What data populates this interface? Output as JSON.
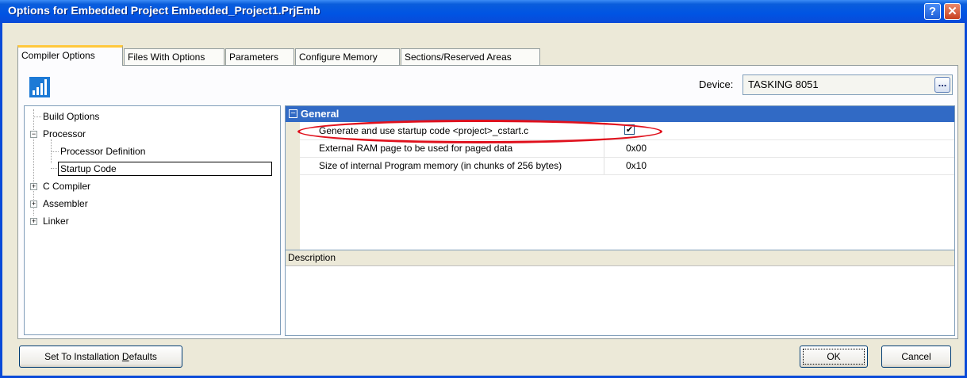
{
  "window": {
    "title": "Options for Embedded Project Embedded_Project1.PrjEmb",
    "help_label": "?",
    "close_label": "✕"
  },
  "tabs": [
    {
      "label": "Compiler Options",
      "active": true
    },
    {
      "label": "Files With Options"
    },
    {
      "label": "Parameters"
    },
    {
      "label": "Configure Memory"
    },
    {
      "label": "Sections/Reserved Areas"
    }
  ],
  "device": {
    "label": "Device:",
    "value": "TASKING 8051",
    "browse_label": "..."
  },
  "tree": {
    "items": [
      {
        "label": "Build Options"
      },
      {
        "label": "Processor",
        "expander": "−"
      },
      {
        "label": "Processor Definition"
      },
      {
        "label": "Startup Code",
        "selected": true
      },
      {
        "label": "C Compiler",
        "expander": "+"
      },
      {
        "label": "Assembler",
        "expander": "+"
      },
      {
        "label": "Linker",
        "expander": "+"
      }
    ]
  },
  "grid": {
    "category": "General",
    "collapse_glyph": "−",
    "rows": [
      {
        "name": "Generate and use startup code <project>_cstart.c",
        "value": "✔",
        "checkbox": true,
        "checked": true
      },
      {
        "name": "External RAM page to be used for paged data",
        "value": "0x00"
      },
      {
        "name": "Size of internal Program memory (in chunks of 256 bytes)",
        "value": "0x10"
      }
    ]
  },
  "description": {
    "title": "Description"
  },
  "buttons": {
    "defaults_pre": "Set To Installation ",
    "defaults_u": "D",
    "defaults_post": "efaults",
    "ok": "OK",
    "cancel": "Cancel"
  },
  "colors": {
    "title_bar": "#0054e3",
    "selection_header": "#316ac5",
    "highlight_ellipse": "#e0101c",
    "active_tab_accent": "#ffc83c"
  }
}
